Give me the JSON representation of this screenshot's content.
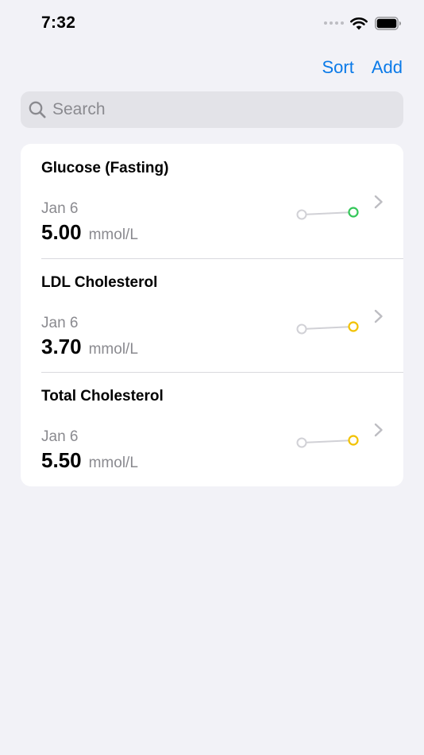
{
  "status_bar": {
    "time": "7:32",
    "icons": [
      "cellular-signal-icon",
      "wifi-icon",
      "battery-icon"
    ]
  },
  "nav": {
    "sort_label": "Sort",
    "add_label": "Add",
    "accent_color": "#0A7AE8"
  },
  "search": {
    "placeholder": "Search",
    "value": ""
  },
  "colors": {
    "background": "#F2F2F7",
    "card": "#FFFFFF",
    "secondary_text": "#8A8A8F",
    "status_green": "#34C759",
    "status_yellow": "#F2C200",
    "previous_point": "#D1D1D6"
  },
  "items": [
    {
      "title": "Glucose (Fasting)",
      "date": "Jan 6",
      "value": "5.00",
      "unit": "mmol/L",
      "status_color": "#34C759"
    },
    {
      "title": "LDL Cholesterol",
      "date": "Jan 6",
      "value": "3.70",
      "unit": "mmol/L",
      "status_color": "#F2C200"
    },
    {
      "title": "Total Cholesterol",
      "date": "Jan 6",
      "value": "5.50",
      "unit": "mmol/L",
      "status_color": "#F2C200"
    }
  ]
}
